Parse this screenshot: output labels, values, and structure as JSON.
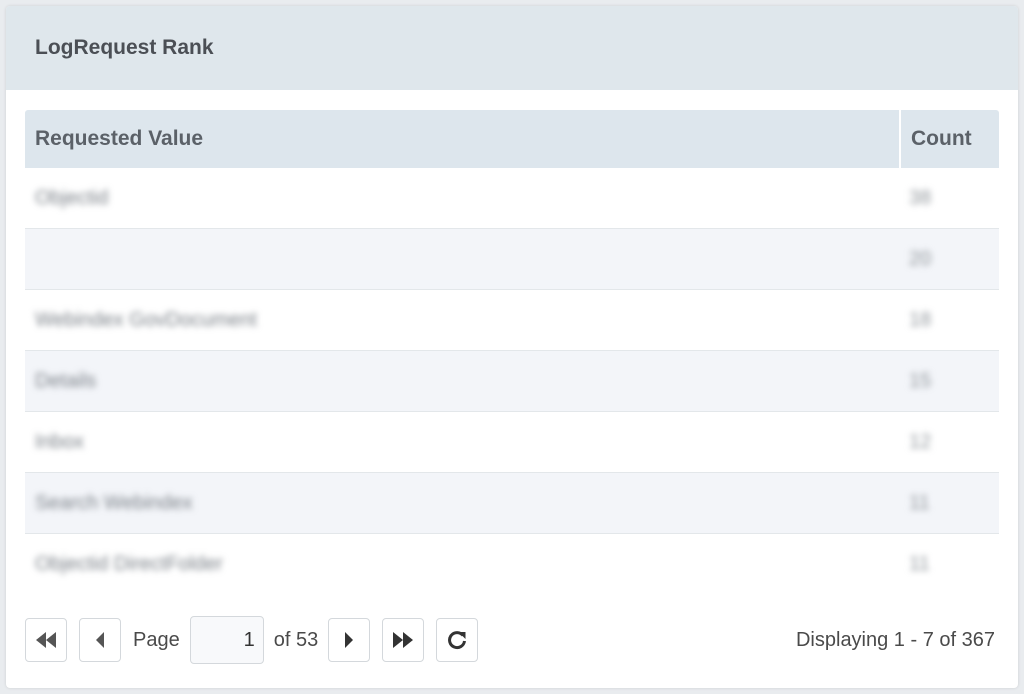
{
  "panel": {
    "title": "LogRequest Rank"
  },
  "grid": {
    "columns": [
      "Requested Value",
      "Count"
    ],
    "rows": [
      {
        "value": "Objectid",
        "count": "38"
      },
      {
        "value": "",
        "count": "20"
      },
      {
        "value": "Webindex GovDocument",
        "count": "18"
      },
      {
        "value": "Details",
        "count": "15"
      },
      {
        "value": "Inbox",
        "count": "12"
      },
      {
        "value": "Search Webindex",
        "count": "11"
      },
      {
        "value": "Objectid DirectFolder",
        "count": "11"
      }
    ]
  },
  "pager": {
    "page_label": "Page",
    "page_value": "1",
    "of_label": "of 53",
    "display_text": "Displaying 1 - 7 of 367"
  },
  "icons": {
    "first": "first-page-icon",
    "prev": "prev-page-icon",
    "next": "next-page-icon",
    "last": "last-page-icon",
    "refresh": "refresh-icon"
  }
}
